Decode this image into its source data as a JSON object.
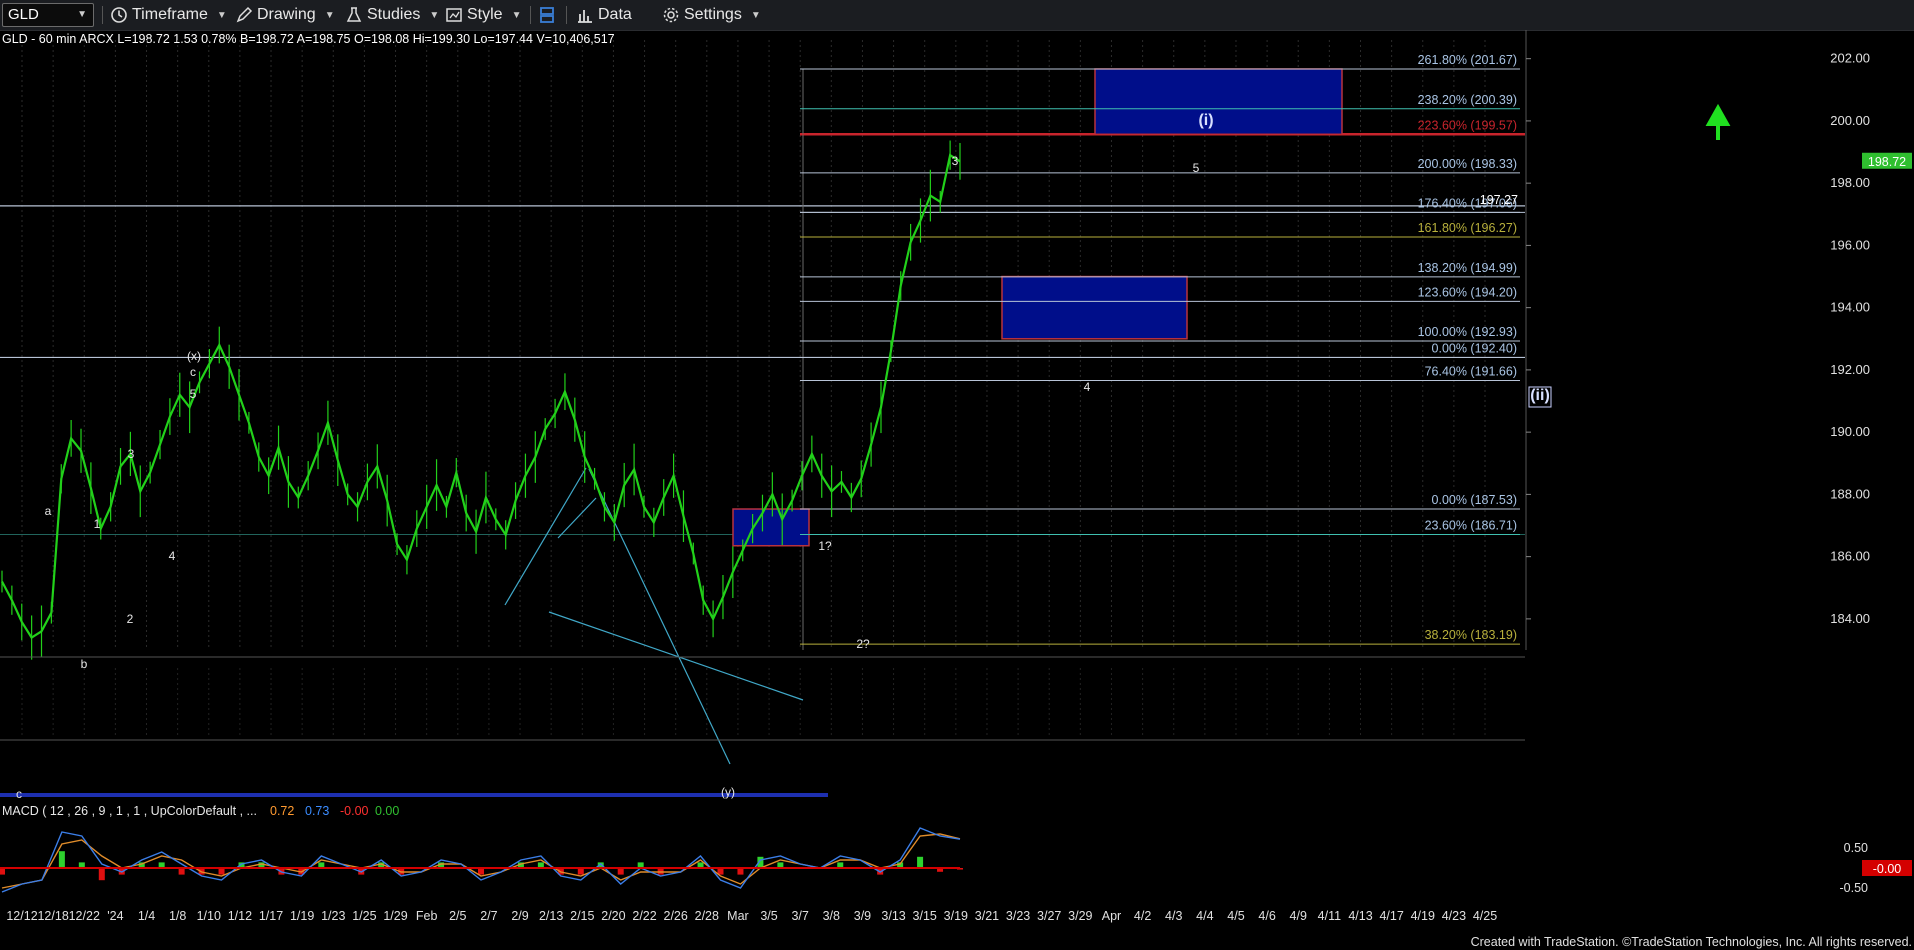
{
  "toolbar": {
    "symbol": "GLD",
    "timeframe_label": "Timeframe",
    "drawing_label": "Drawing",
    "studies_label": "Studies",
    "style_label": "Style",
    "data_label": "Data",
    "settings_label": "Settings"
  },
  "quote_line": "GLD - 60 min  ARCX  L=198.72  1.53  0.78%  B=198.72  A=198.75  O=198.08  Hi=199.30  Lo=197.44  V=10,406,517",
  "footer": "Created with TradeStation. ©TradeStation Technologies, Inc. All rights reserved.",
  "colors": {
    "background": "#000000",
    "candles": "#22d11a",
    "fib_line": "#b7c3d6",
    "fib_label": "#a9c4e4",
    "fib_gold": "#b8b03c",
    "fib_teal": "#3fbfb0",
    "box_fill": "#000e8a",
    "box_border": "#b8323e",
    "red_line": "#c8242c",
    "channel": "#40a8c8",
    "price_tag": "#2fbf2f",
    "macd_line": "#3b7ee8",
    "signal_line": "#e08c2a",
    "hist_pos": "#2ed12e",
    "hist_neg": "#e01010",
    "arrow": "#20e020"
  },
  "chart_data": {
    "type": "line",
    "title": "GLD - 60 min",
    "y_axis": {
      "ticks": [
        "202.00",
        "200.00",
        "198.00",
        "196.00",
        "194.00",
        "192.00",
        "190.00",
        "188.00",
        "186.00",
        "184.00"
      ],
      "range": [
        183.0,
        202.6
      ]
    },
    "x_axis": {
      "tick_labels": [
        "12/12",
        "12/18",
        "12/22",
        "'24",
        "1/4",
        "1/8",
        "1/10",
        "1/12",
        "1/17",
        "1/19",
        "1/23",
        "1/25",
        "1/29",
        "Feb",
        "2/5",
        "2/7",
        "2/9",
        "2/13",
        "2/15",
        "2/20",
        "2/22",
        "2/26",
        "2/28",
        "Mar",
        "3/5",
        "3/7",
        "3/8",
        "3/9",
        "3/13",
        "3/15",
        "3/19",
        "3/21",
        "3/23",
        "3/27",
        "3/29",
        "Apr",
        "4/2",
        "4/3",
        "4/4",
        "4/5",
        "4/6",
        "4/9",
        "4/11",
        "4/13",
        "4/17",
        "4/19",
        "4/23",
        "4/25"
      ]
    },
    "price_series": {
      "name": "GLD close (approx)",
      "values": [
        185.2,
        184.6,
        183.9,
        183.4,
        183.6,
        184.2,
        188.5,
        189.8,
        189.4,
        188.2,
        186.9,
        187.6,
        188.9,
        189.3,
        188.1,
        188.7,
        189.6,
        190.5,
        191.2,
        190.8,
        191.6,
        192.2,
        192.8,
        192.1,
        191.2,
        190.3,
        189.2,
        188.6,
        189.5,
        188.4,
        187.9,
        188.6,
        189.4,
        190.3,
        189.1,
        188.0,
        187.6,
        188.4,
        188.9,
        187.8,
        186.4,
        185.9,
        186.9,
        187.6,
        188.3,
        187.6,
        188.7,
        187.4,
        186.8,
        187.9,
        187.2,
        186.7,
        187.8,
        188.6,
        189.2,
        190.1,
        190.6,
        191.3,
        190.4,
        189.2,
        188.5,
        187.6,
        187.1,
        188.3,
        188.8,
        187.6,
        187.1,
        187.9,
        188.6,
        187.3,
        186.1,
        184.6,
        184.0,
        184.7,
        185.5,
        186.2,
        186.9,
        187.4,
        188.0,
        187.2,
        187.8,
        188.6,
        189.3,
        188.6,
        188.1,
        188.4,
        187.9,
        188.5,
        189.6,
        190.8,
        192.6,
        194.7,
        196.1,
        196.8,
        197.6,
        197.4,
        198.9,
        198.7
      ],
      "last": 198.72
    },
    "current_price_tag": "198.72",
    "marker_price": "197.27",
    "fib_levels": [
      {
        "label": "261.80% (201.67)",
        "price": 201.67
      },
      {
        "label": "238.20% (200.39)",
        "price": 200.39
      },
      {
        "label": "223.60% (199.57)",
        "price": 199.57
      },
      {
        "label": "200.00% (198.33)",
        "price": 198.33
      },
      {
        "label": "176.40% (197.06)",
        "price": 197.06
      },
      {
        "label": "161.80% (196.27)",
        "price": 196.27
      },
      {
        "label": "138.20% (194.99)",
        "price": 194.99
      },
      {
        "label": "123.60% (194.20)",
        "price": 194.2
      },
      {
        "label": "100.00% (192.93)",
        "price": 192.93
      },
      {
        "label": "0.00% (192.40)",
        "price": 192.4
      },
      {
        "label": "76.40% (191.66)",
        "price": 191.66
      },
      {
        "label": "0.00% (187.53)",
        "price": 187.53
      },
      {
        "label": "23.60% (186.71)",
        "price": 186.71
      },
      {
        "label": "38.20% (183.19)",
        "price": 183.19
      }
    ],
    "wave_labels": [
      "a",
      "b",
      "c",
      "1",
      "2",
      "3",
      "4",
      "5",
      "c",
      "(x)",
      "1?",
      "2?",
      "3",
      "4",
      "5",
      "(i)",
      "(ii)",
      "(y)"
    ],
    "macd": {
      "label": "MACD ( 12 , 26 , 9 , 1 , 1 , UpColorDefault , ...",
      "values": [
        "0.72",
        "0.73",
        "-0.00",
        "0.00"
      ],
      "y_ticks": [
        "0.50",
        "-0.50"
      ],
      "current_tag": "-0.00",
      "macd_series": [
        -0.6,
        -0.4,
        -0.3,
        0.9,
        0.8,
        0.1,
        -0.1,
        0.2,
        0.4,
        0.1,
        -0.2,
        -0.3,
        0.1,
        0.2,
        -0.1,
        -0.2,
        0.3,
        0.1,
        -0.1,
        0.2,
        -0.2,
        -0.1,
        0.2,
        0.1,
        -0.3,
        -0.1,
        0.2,
        0.3,
        -0.2,
        -0.3,
        0.1,
        -0.4,
        0.0,
        -0.2,
        -0.1,
        0.3,
        -0.3,
        -0.5,
        0.2,
        0.3,
        0.1,
        0.0,
        0.3,
        0.2,
        -0.1,
        0.2,
        1.0,
        0.8,
        0.72
      ],
      "signal_series": [
        -0.5,
        -0.4,
        -0.3,
        0.6,
        0.7,
        0.3,
        0.0,
        0.1,
        0.3,
        0.2,
        -0.1,
        -0.2,
        0.0,
        0.1,
        0.0,
        -0.1,
        0.2,
        0.1,
        0.0,
        0.1,
        -0.1,
        -0.1,
        0.1,
        0.1,
        -0.2,
        -0.1,
        0.1,
        0.2,
        -0.1,
        -0.2,
        0.0,
        -0.3,
        -0.1,
        -0.1,
        -0.1,
        0.2,
        -0.2,
        -0.4,
        0.0,
        0.2,
        0.1,
        0.0,
        0.2,
        0.2,
        0.0,
        0.1,
        0.8,
        0.85,
        0.73
      ]
    }
  }
}
